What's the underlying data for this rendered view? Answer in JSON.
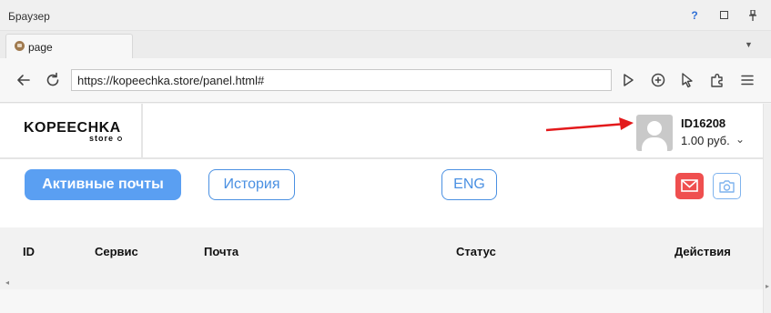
{
  "window": {
    "title": "Браузер",
    "help_label": "?"
  },
  "tabs": [
    {
      "label": "page"
    }
  ],
  "toolbar": {
    "url": "https://kopeechka.store/panel.html#"
  },
  "site": {
    "logo_main": "KOPEECHKA",
    "logo_sub": "store",
    "user_id": "ID16208",
    "balance": "1.00 руб.",
    "nav": {
      "active_mail_label": "Активные почты",
      "history_label": "История",
      "lang_label": "ENG"
    },
    "table": {
      "columns": [
        "ID",
        "Сервис",
        "Почта",
        "Статус",
        "Действия"
      ]
    }
  },
  "colors": {
    "primary": "#5a9ff2",
    "outline": "#4a90e2",
    "mail_button": "#ef4f4f",
    "arrow": "#e3191b"
  },
  "icons": {
    "back": "arrow-left-icon",
    "reload": "reload-icon",
    "play": "play-icon",
    "add": "add-circle-icon",
    "cursor": "cursor-icon",
    "extension": "puzzle-icon",
    "menu": "hamburger-icon",
    "mail": "mail-icon",
    "camera": "camera-icon"
  }
}
